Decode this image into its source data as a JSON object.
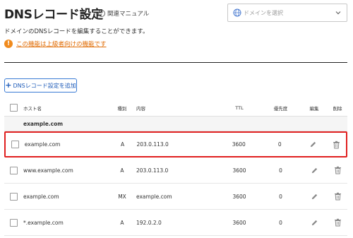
{
  "header": {
    "title": "DNSレコード設定",
    "help_label": "関連マニュアル",
    "help_mark": "?",
    "domain_placeholder": "ドメインを選択"
  },
  "description": "ドメインのDNSレコードを編集することができます。",
  "notice": {
    "icon_mark": "!",
    "text": "この機能は上級者向けの機能です"
  },
  "toolbar": {
    "add_label": "DNSレコード設定を追加",
    "add_mark": "+"
  },
  "table": {
    "columns": {
      "host": "ホスト名",
      "type": "種別",
      "content": "内容",
      "ttl": "TTL",
      "priority": "優先度",
      "edit": "編集",
      "delete": "削除"
    },
    "group": "example.com",
    "rows": [
      {
        "host": "example.com",
        "type": "A",
        "content": "203.0.113.0",
        "ttl": "3600",
        "priority": "0"
      },
      {
        "host": "www.example.com",
        "type": "A",
        "content": "203.0.113.0",
        "ttl": "3600",
        "priority": "0"
      },
      {
        "host": "example.com",
        "type": "MX",
        "content": "example.com",
        "ttl": "3600",
        "priority": "0"
      },
      {
        "host": "*.example.com",
        "type": "A",
        "content": "192.0.2.0",
        "ttl": "3600",
        "priority": "0"
      }
    ]
  },
  "colors": {
    "accent": "#1e5bb8",
    "warning": "#f08a1c",
    "highlight": "#e02020"
  },
  "icons": [
    "help-icon",
    "globe-icon",
    "chevron-down-icon",
    "warning-icon",
    "pencil-icon",
    "trash-icon"
  ]
}
